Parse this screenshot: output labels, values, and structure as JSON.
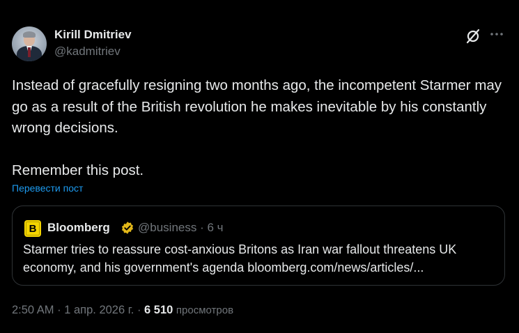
{
  "author": {
    "name": "Kirill Dmitriev",
    "handle": "@kadmitriev"
  },
  "icons": {
    "grok": "grok-icon",
    "more": "more-options-icon",
    "verified": "verified-badge-icon"
  },
  "post": {
    "paragraph1": "Instead of gracefully resigning two months ago, the incompetent Starmer may go as a result of the British revolution he makes inevitable by his constantly wrong decisions.",
    "paragraph2": "Remember this post.",
    "translate_label": "Перевести пост"
  },
  "quote": {
    "logo_letter": "B",
    "name": "Bloomberg",
    "handle": "@business",
    "separator": "·",
    "time": "6 ч",
    "text": "Starmer tries to reassure cost-anxious Britons as Iran war fallout threatens UK economy, and his government's agenda bloomberg.com/news/articles/..."
  },
  "footer": {
    "time": "2:50 AM",
    "date": "1 апр. 2026 г.",
    "views_count": "6 510",
    "views_label": "просмотров"
  },
  "colors": {
    "background": "#000000",
    "text": "#e7e9ea",
    "muted": "#71767b",
    "link": "#1d9bf0",
    "border": "#2f3336",
    "bloomberg_yellow": "#f5d500",
    "verified_gold": "#e2b719"
  }
}
